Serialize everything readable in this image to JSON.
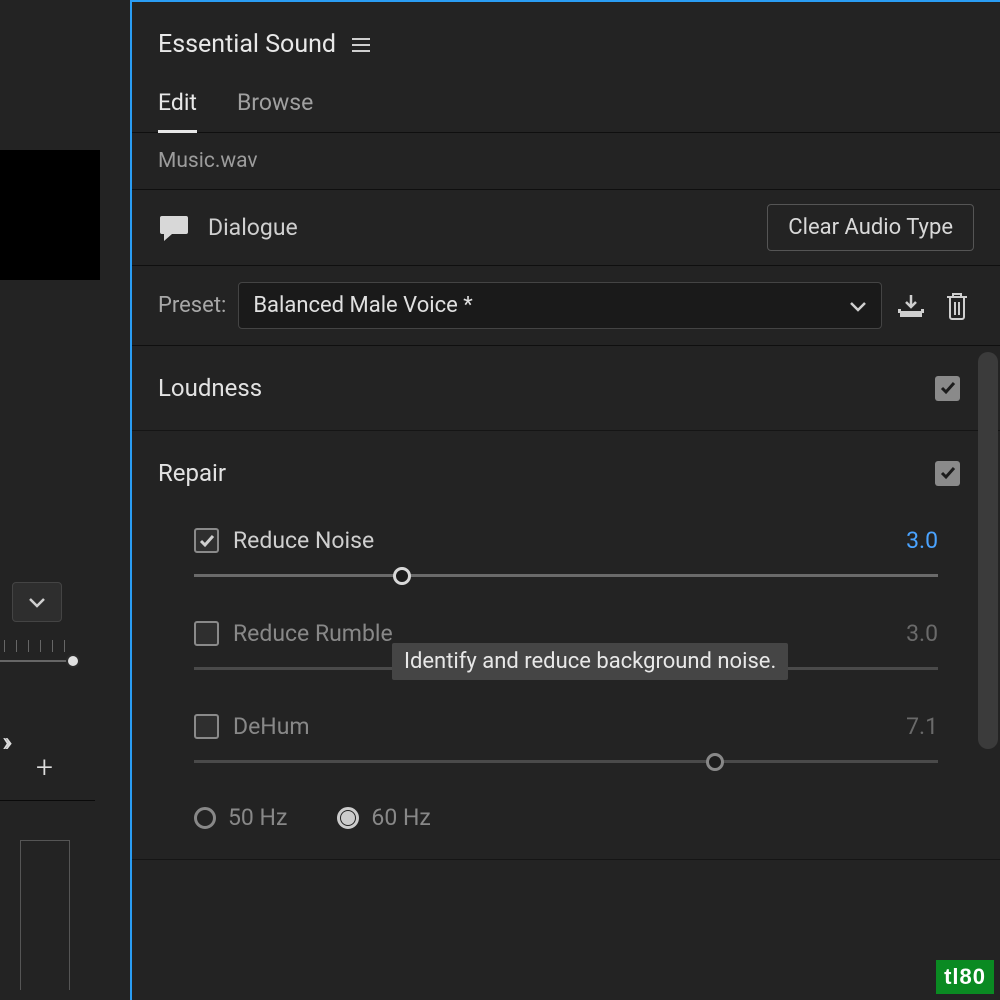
{
  "panel": {
    "title": "Essential Sound",
    "filename": "Music.wav"
  },
  "tabs": {
    "edit": "Edit",
    "browse": "Browse"
  },
  "audioType": {
    "label": "Dialogue",
    "clear": "Clear Audio Type"
  },
  "preset": {
    "label": "Preset:",
    "value": "Balanced Male Voice *"
  },
  "sections": {
    "loudness": {
      "title": "Loudness",
      "checked": true
    },
    "repair": {
      "title": "Repair",
      "checked": true
    }
  },
  "repair": {
    "reduceNoise": {
      "label": "Reduce Noise",
      "value": "3.0",
      "checked": true,
      "pos": 28
    },
    "reduceRumble": {
      "label": "Reduce Rumble",
      "value": "3.0",
      "checked": false,
      "pos": 30
    },
    "dehum": {
      "label": "DeHum",
      "value": "7.1",
      "checked": false,
      "pos": 70
    },
    "freq50": "50 Hz",
    "freq60": "60 Hz"
  },
  "tooltip": "Identify and reduce background noise.",
  "watermark": "tl80"
}
